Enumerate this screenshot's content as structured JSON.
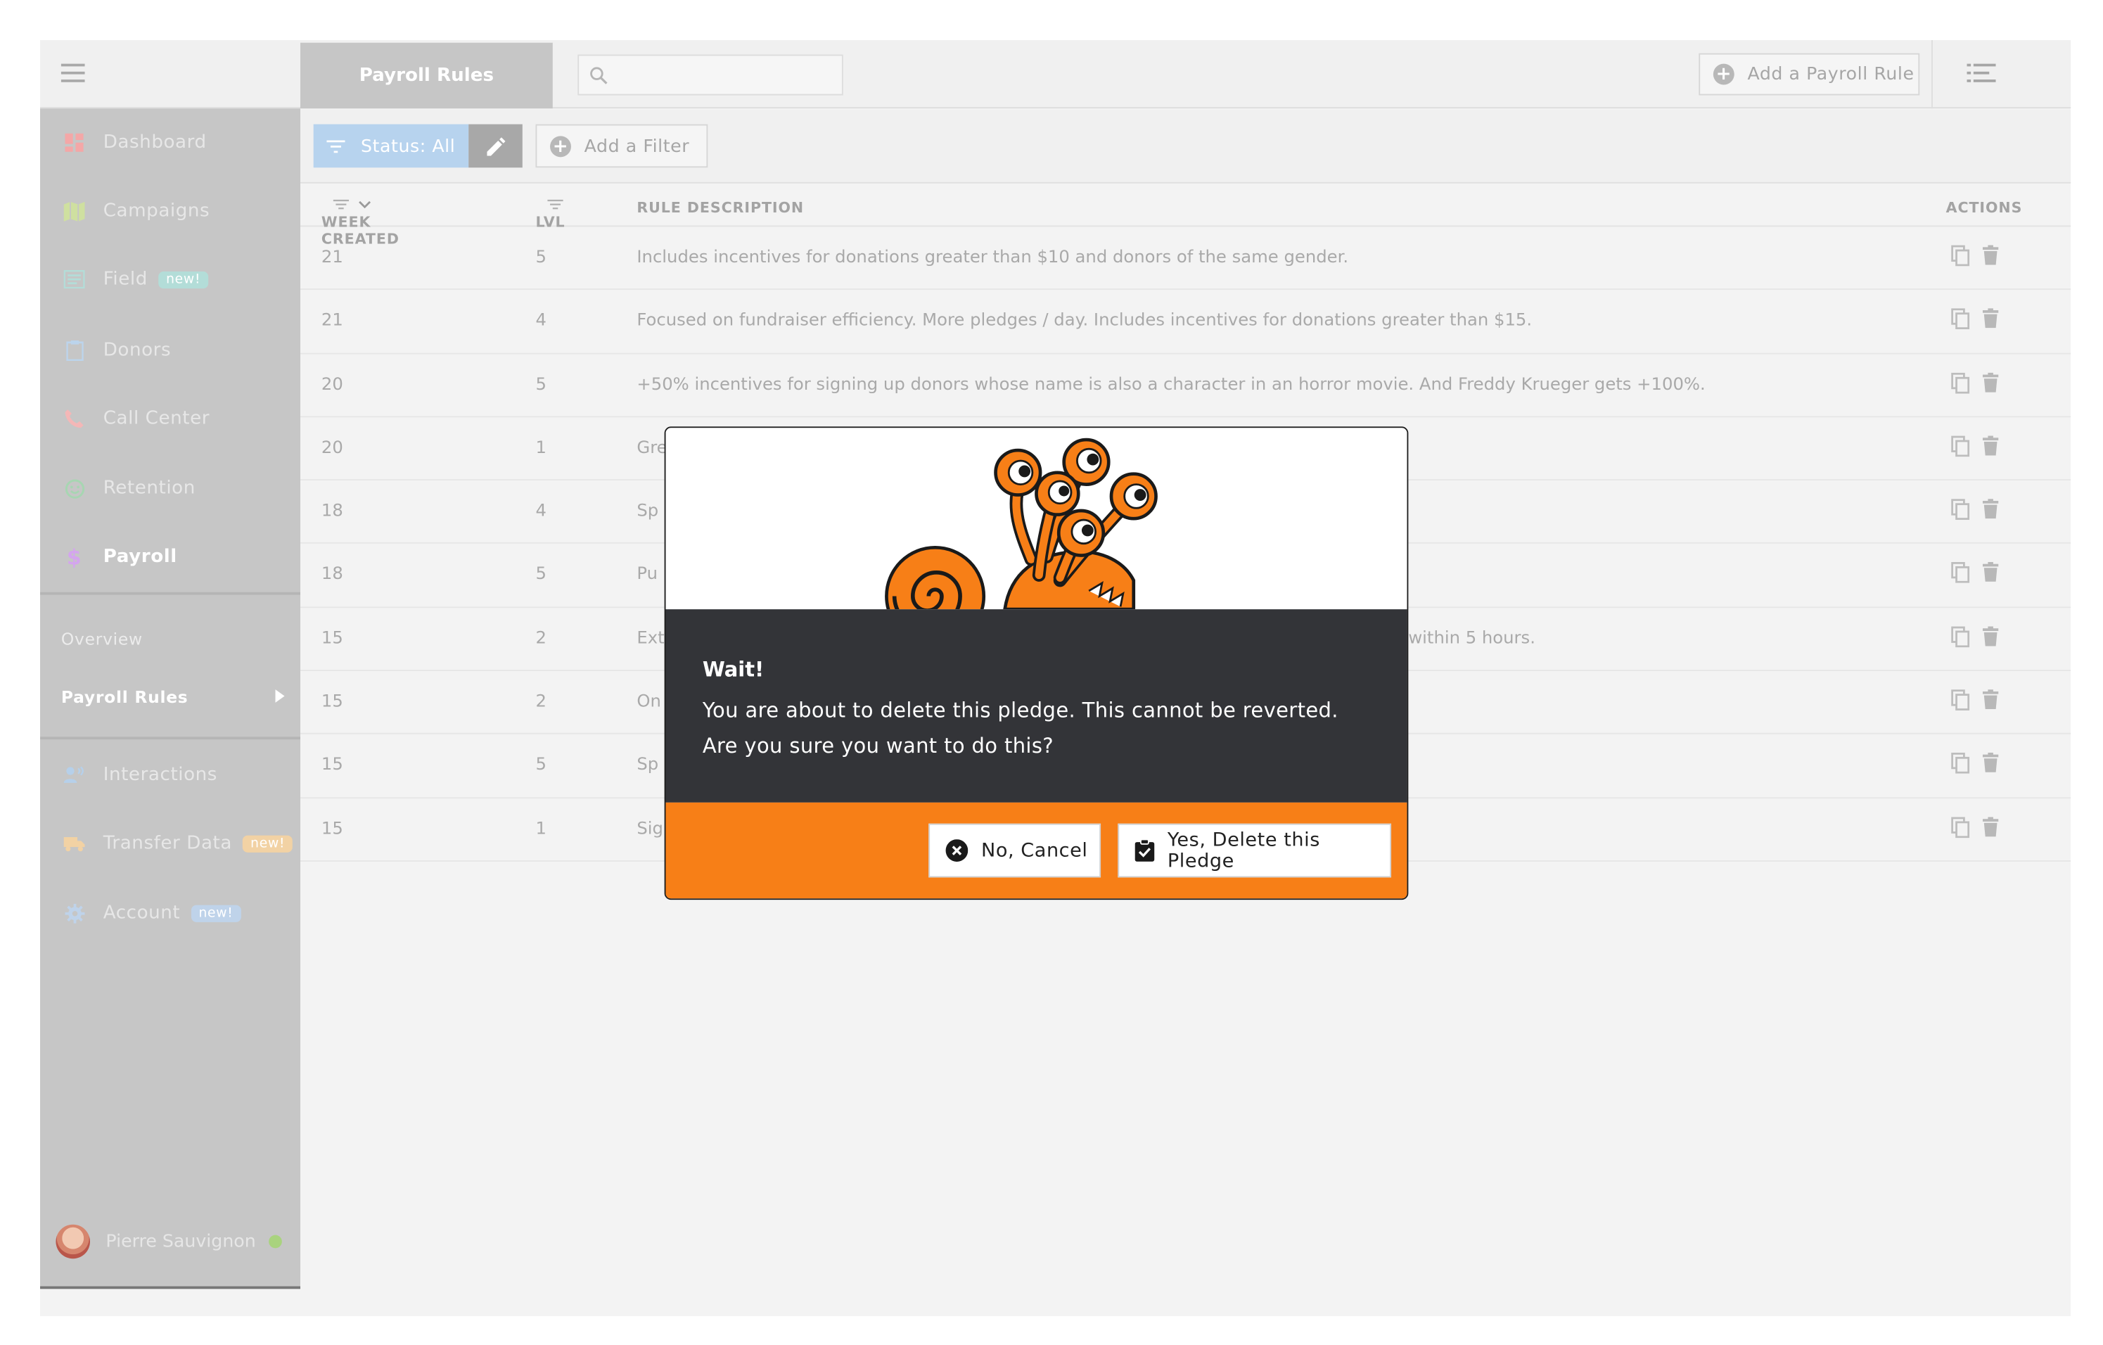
{
  "topbar": {
    "title": "Payroll Rules",
    "search_placeholder": "",
    "add_rule_label": "Add a Payroll Rule"
  },
  "sidebar": {
    "nav": [
      {
        "label": "Dashboard",
        "icon": "dashboard-icon",
        "color": "#f4a7a7"
      },
      {
        "label": "Campaigns",
        "icon": "map-icon",
        "color": "#cfe0a0"
      },
      {
        "label": "Field",
        "icon": "field-icon",
        "color": "#b3ddd8",
        "badge": "new!"
      },
      {
        "label": "Donors",
        "icon": "clipboard-icon",
        "color": "#bcd4ec"
      },
      {
        "label": "Call Center",
        "icon": "phone-icon",
        "color": "#f4b7b7"
      },
      {
        "label": "Retention",
        "icon": "smiley-icon",
        "color": "#a7d6b2"
      },
      {
        "label": "Payroll",
        "icon": "dollar-icon",
        "color": "#d4a5ee",
        "active": true
      }
    ],
    "sub": [
      {
        "label": "Overview"
      },
      {
        "label": "Payroll Rules",
        "active": true
      }
    ],
    "nav2": [
      {
        "label": "Interactions",
        "icon": "people-icon",
        "color": "#b6d0ea"
      },
      {
        "label": "Transfer Data",
        "icon": "truck-icon",
        "color": "#f2d2a4",
        "badge": "new!"
      },
      {
        "label": "Account",
        "icon": "gear-icon",
        "color": "#bfd3ea",
        "badge": "new!"
      }
    ],
    "user": {
      "name": "Pierre Sauvignon"
    }
  },
  "filters": {
    "status_label": "Status: All",
    "add_filter_label": "Add a Filter"
  },
  "table": {
    "headers": {
      "week": "WEEK CREATED",
      "lvl": "LVL",
      "desc": "RULE DESCRIPTION",
      "actions": "ACTIONS"
    },
    "rows": [
      {
        "week": "21",
        "lvl": "5",
        "desc": "Includes incentives for donations greater than $10 and donors of the same gender."
      },
      {
        "week": "21",
        "lvl": "4",
        "desc": "Focused on fundraiser efficiency. More pledges / day. Includes incentives for donations greater than $15."
      },
      {
        "week": "20",
        "lvl": "5",
        "desc": "+50% incentives for signing up donors whose name is also a character in an horror movie. And Freddy Krueger gets +100%."
      },
      {
        "week": "20",
        "lvl": "1",
        "desc": "Gre"
      },
      {
        "week": "18",
        "lvl": "4",
        "desc": "Sp"
      },
      {
        "week": "18",
        "lvl": "5",
        "desc": "Pu"
      },
      {
        "week": "15",
        "lvl": "2",
        "desc": "Ext",
        "desc_tail": "within 5 hours."
      },
      {
        "week": "15",
        "lvl": "2",
        "desc": "On"
      },
      {
        "week": "15",
        "lvl": "5",
        "desc": "Sp"
      },
      {
        "week": "15",
        "lvl": "1",
        "desc": "Sig"
      }
    ]
  },
  "modal": {
    "heading": "Wait!",
    "line1": "You are about to delete this pledge. This cannot be reverted.",
    "line2": "Are you sure you want to do this?",
    "cancel_label": "No, Cancel",
    "confirm_label": "Yes, Delete this Pledge"
  },
  "colors": {
    "accent_orange": "#f77f17",
    "modal_dark": "#333438",
    "sidebar_bg": "#c6c6c6",
    "chip_blue": "#b7d3ee",
    "online": "#a9d37e"
  }
}
